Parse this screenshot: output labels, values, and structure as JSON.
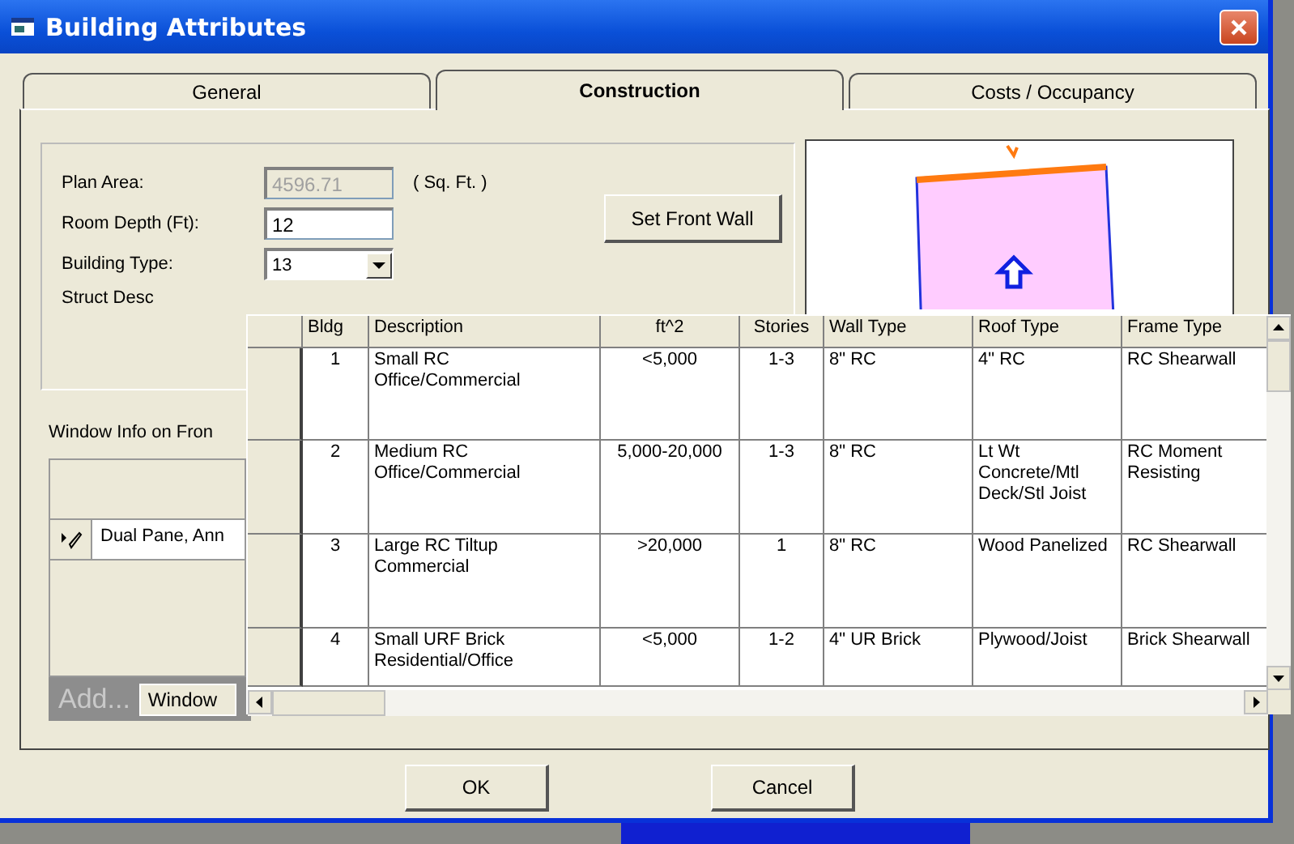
{
  "window": {
    "title": "Building Attributes"
  },
  "tabs": [
    {
      "label": "General",
      "selected": false
    },
    {
      "label": "Construction",
      "selected": true
    },
    {
      "label": "Costs / Occupancy",
      "selected": false
    }
  ],
  "fields": [
    {
      "label": "Plan Area:",
      "value": "4596.71",
      "disabled": true,
      "unit": "( Sq. Ft. )",
      "kind": "text"
    },
    {
      "label": "Room Depth (Ft):",
      "value": "12",
      "disabled": false,
      "kind": "text"
    },
    {
      "label": "Building Type:",
      "value": "13",
      "disabled": false,
      "kind": "dropdown"
    },
    {
      "label": "Struct Desc",
      "kind": "label"
    }
  ],
  "set_front_wall_button": "Set Front Wall",
  "window_info": {
    "label": "Window Info on Fron",
    "rows": [
      "Dual Pane, Ann"
    ],
    "add_label": "Add...",
    "window_button": "Window"
  },
  "building_type_list": {
    "columns": [
      "Bldg",
      "Description",
      "ft^2",
      "Stories",
      "Wall Type",
      "Roof Type",
      "Frame Type"
    ],
    "rows": [
      [
        "1",
        "Small RC Office/Commercial",
        "<5,000",
        "1-3",
        "8\" RC",
        "4\" RC",
        "RC Shearwall"
      ],
      [
        "2",
        "Medium RC Office/Commercial",
        "5,000-20,000",
        "1-3",
        "8\" RC",
        "Lt Wt Concrete/Mtl Deck/Stl Joist",
        "RC Moment Resisting"
      ],
      [
        "3",
        "Large RC Tiltup Commercial",
        ">20,000",
        "1",
        "8\" RC",
        "Wood Panelized",
        "RC Shearwall"
      ],
      [
        "4",
        "Small URF Brick Residential/Office",
        "<5,000",
        "1-2",
        "4\" UR Brick",
        "Plywood/Joist",
        "Brick Shearwall"
      ]
    ]
  },
  "buttons": [
    "OK",
    "Cancel"
  ]
}
